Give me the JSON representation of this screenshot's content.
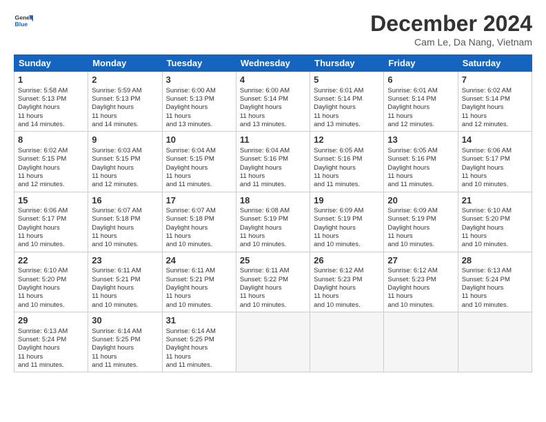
{
  "logo": {
    "general": "General",
    "blue": "Blue"
  },
  "title": "December 2024",
  "location": "Cam Le, Da Nang, Vietnam",
  "days_header": [
    "Sunday",
    "Monday",
    "Tuesday",
    "Wednesday",
    "Thursday",
    "Friday",
    "Saturday"
  ],
  "weeks": [
    [
      {
        "day": "1",
        "sunrise": "5:58 AM",
        "sunset": "5:13 PM",
        "daylight": "11 hours and 14 minutes."
      },
      {
        "day": "2",
        "sunrise": "5:59 AM",
        "sunset": "5:13 PM",
        "daylight": "11 hours and 14 minutes."
      },
      {
        "day": "3",
        "sunrise": "6:00 AM",
        "sunset": "5:13 PM",
        "daylight": "11 hours and 13 minutes."
      },
      {
        "day": "4",
        "sunrise": "6:00 AM",
        "sunset": "5:14 PM",
        "daylight": "11 hours and 13 minutes."
      },
      {
        "day": "5",
        "sunrise": "6:01 AM",
        "sunset": "5:14 PM",
        "daylight": "11 hours and 13 minutes."
      },
      {
        "day": "6",
        "sunrise": "6:01 AM",
        "sunset": "5:14 PM",
        "daylight": "11 hours and 12 minutes."
      },
      {
        "day": "7",
        "sunrise": "6:02 AM",
        "sunset": "5:14 PM",
        "daylight": "11 hours and 12 minutes."
      }
    ],
    [
      {
        "day": "8",
        "sunrise": "6:02 AM",
        "sunset": "5:15 PM",
        "daylight": "11 hours and 12 minutes."
      },
      {
        "day": "9",
        "sunrise": "6:03 AM",
        "sunset": "5:15 PM",
        "daylight": "11 hours and 12 minutes."
      },
      {
        "day": "10",
        "sunrise": "6:04 AM",
        "sunset": "5:15 PM",
        "daylight": "11 hours and 11 minutes."
      },
      {
        "day": "11",
        "sunrise": "6:04 AM",
        "sunset": "5:16 PM",
        "daylight": "11 hours and 11 minutes."
      },
      {
        "day": "12",
        "sunrise": "6:05 AM",
        "sunset": "5:16 PM",
        "daylight": "11 hours and 11 minutes."
      },
      {
        "day": "13",
        "sunrise": "6:05 AM",
        "sunset": "5:16 PM",
        "daylight": "11 hours and 11 minutes."
      },
      {
        "day": "14",
        "sunrise": "6:06 AM",
        "sunset": "5:17 PM",
        "daylight": "11 hours and 10 minutes."
      }
    ],
    [
      {
        "day": "15",
        "sunrise": "6:06 AM",
        "sunset": "5:17 PM",
        "daylight": "11 hours and 10 minutes."
      },
      {
        "day": "16",
        "sunrise": "6:07 AM",
        "sunset": "5:18 PM",
        "daylight": "11 hours and 10 minutes."
      },
      {
        "day": "17",
        "sunrise": "6:07 AM",
        "sunset": "5:18 PM",
        "daylight": "11 hours and 10 minutes."
      },
      {
        "day": "18",
        "sunrise": "6:08 AM",
        "sunset": "5:19 PM",
        "daylight": "11 hours and 10 minutes."
      },
      {
        "day": "19",
        "sunrise": "6:09 AM",
        "sunset": "5:19 PM",
        "daylight": "11 hours and 10 minutes."
      },
      {
        "day": "20",
        "sunrise": "6:09 AM",
        "sunset": "5:19 PM",
        "daylight": "11 hours and 10 minutes."
      },
      {
        "day": "21",
        "sunrise": "6:10 AM",
        "sunset": "5:20 PM",
        "daylight": "11 hours and 10 minutes."
      }
    ],
    [
      {
        "day": "22",
        "sunrise": "6:10 AM",
        "sunset": "5:20 PM",
        "daylight": "11 hours and 10 minutes."
      },
      {
        "day": "23",
        "sunrise": "6:11 AM",
        "sunset": "5:21 PM",
        "daylight": "11 hours and 10 minutes."
      },
      {
        "day": "24",
        "sunrise": "6:11 AM",
        "sunset": "5:21 PM",
        "daylight": "11 hours and 10 minutes."
      },
      {
        "day": "25",
        "sunrise": "6:11 AM",
        "sunset": "5:22 PM",
        "daylight": "11 hours and 10 minutes."
      },
      {
        "day": "26",
        "sunrise": "6:12 AM",
        "sunset": "5:23 PM",
        "daylight": "11 hours and 10 minutes."
      },
      {
        "day": "27",
        "sunrise": "6:12 AM",
        "sunset": "5:23 PM",
        "daylight": "11 hours and 10 minutes."
      },
      {
        "day": "28",
        "sunrise": "6:13 AM",
        "sunset": "5:24 PM",
        "daylight": "11 hours and 10 minutes."
      }
    ],
    [
      {
        "day": "29",
        "sunrise": "6:13 AM",
        "sunset": "5:24 PM",
        "daylight": "11 hours and 11 minutes."
      },
      {
        "day": "30",
        "sunrise": "6:14 AM",
        "sunset": "5:25 PM",
        "daylight": "11 hours and 11 minutes."
      },
      {
        "day": "31",
        "sunrise": "6:14 AM",
        "sunset": "5:25 PM",
        "daylight": "11 hours and 11 minutes."
      },
      null,
      null,
      null,
      null
    ]
  ]
}
